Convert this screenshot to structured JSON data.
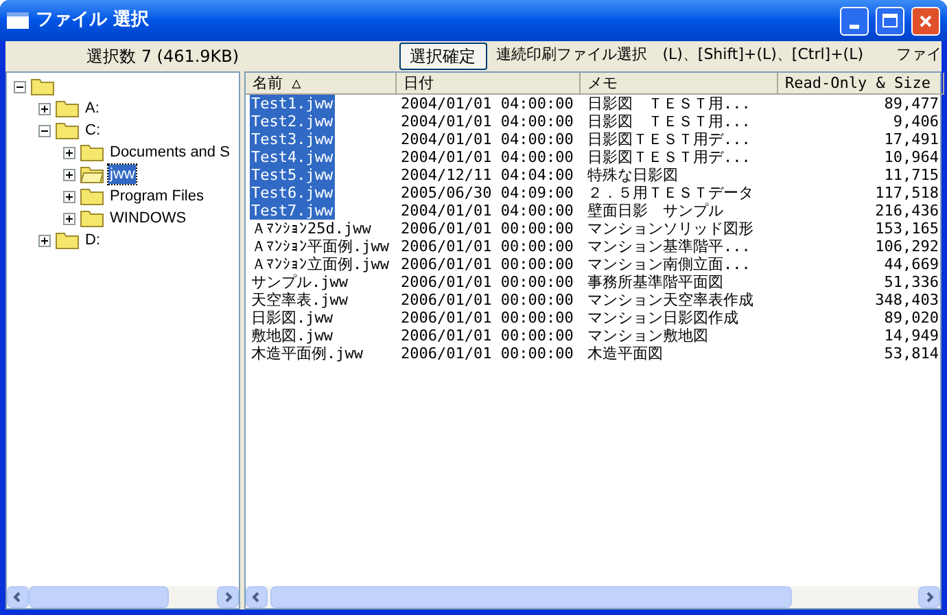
{
  "window": {
    "title": "ファイル 選択"
  },
  "toolbar": {
    "selection_info": "選択数 7 (461.9KB)",
    "confirm_button": "選択確定",
    "hint": "連続印刷ファイル選択　(L)、[Shift]+(L)、[Ctrl]+(L)",
    "cut_label": "ファイ"
  },
  "tree": [
    {
      "expanded": true,
      "selected": false,
      "children": [
        {
          "label": "A:",
          "expanded": false,
          "selected": false
        },
        {
          "label": "C:",
          "expanded": true,
          "selected": false,
          "children": [
            {
              "label": "Documents and S",
              "expanded": false,
              "selected": false
            },
            {
              "label": "jww",
              "expanded": false,
              "selected": true
            },
            {
              "label": "Program Files",
              "expanded": false,
              "selected": false
            },
            {
              "label": "WINDOWS",
              "expanded": false,
              "selected": false
            }
          ]
        },
        {
          "label": "D:",
          "expanded": false,
          "selected": false
        }
      ]
    }
  ],
  "table": {
    "columns": [
      "名前 △",
      "日付",
      "メモ",
      "Read-Only & Size"
    ],
    "rows": [
      {
        "name": "Test1.jww",
        "date": "2004/01/01 04:00:00",
        "memo": "日影図　ＴＥＳＴ用...",
        "size": "89,477",
        "selected": true
      },
      {
        "name": "Test2.jww",
        "date": "2004/01/01 04:00:00",
        "memo": "日影図　ＴＥＳＴ用...",
        "size": "9,406",
        "selected": true
      },
      {
        "name": "Test3.jww",
        "date": "2004/01/01 04:00:00",
        "memo": "日影図ＴＥＳＴ用デ...",
        "size": "17,491",
        "selected": true
      },
      {
        "name": "Test4.jww",
        "date": "2004/01/01 04:00:00",
        "memo": "日影図ＴＥＳＴ用デ...",
        "size": "10,964",
        "selected": true
      },
      {
        "name": "Test5.jww",
        "date": "2004/12/11 04:04:00",
        "memo": "特殊な日影図",
        "size": "11,715",
        "selected": true
      },
      {
        "name": "Test6.jww",
        "date": "2005/06/30 04:09:00",
        "memo": "２．５用ＴＥＳＴデータ",
        "size": "117,518",
        "selected": true
      },
      {
        "name": "Test7.jww",
        "date": "2004/01/01 04:00:00",
        "memo": "壁面日影　サンプル",
        "size": "216,436",
        "selected": true
      },
      {
        "name": "Ａﾏﾝｼｮﾝ25d.jww",
        "date": "2006/01/01 00:00:00",
        "memo": "マンションソリッド図形",
        "size": "153,165",
        "selected": false
      },
      {
        "name": "Ａﾏﾝｼｮﾝ平面例.jww",
        "date": "2006/01/01 00:00:00",
        "memo": "マンション基準階平...",
        "size": "106,292",
        "selected": false
      },
      {
        "name": "Ａﾏﾝｼｮﾝ立面例.jww",
        "date": "2006/01/01 00:00:00",
        "memo": "マンション南側立面...",
        "size": "44,669",
        "selected": false
      },
      {
        "name": "サンプル.jww",
        "date": "2006/01/01 00:00:00",
        "memo": "事務所基準階平面図",
        "size": "51,336",
        "selected": false
      },
      {
        "name": "天空率表.jww",
        "date": "2006/01/01 00:00:00",
        "memo": "マンション天空率表作成",
        "size": "348,403",
        "selected": false
      },
      {
        "name": "日影図.jww",
        "date": "2006/01/01 00:00:00",
        "memo": "マンション日影図作成",
        "size": "89,020",
        "selected": false
      },
      {
        "name": "敷地図.jww",
        "date": "2006/01/01 00:00:00",
        "memo": "マンション敷地図",
        "size": "14,949",
        "selected": false
      },
      {
        "name": "木造平面例.jww",
        "date": "2006/01/01 00:00:00",
        "memo": "木造平面図",
        "size": "53,814",
        "selected": false
      }
    ]
  }
}
